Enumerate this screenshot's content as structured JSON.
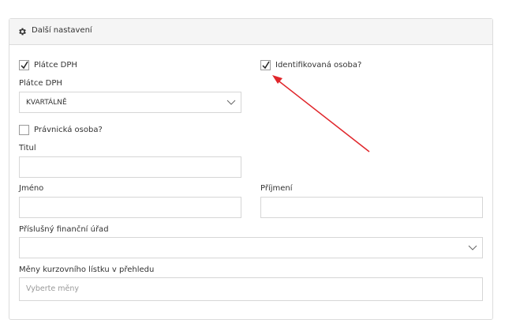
{
  "panel": {
    "title": "Další nastavení",
    "icon": "gear-icon"
  },
  "vat_payer_checkbox": {
    "label": "Plátce DPH",
    "checked": true
  },
  "identified_person_checkbox": {
    "label": "Identifikovaná osoba?",
    "checked": true
  },
  "vat_period": {
    "label": "Plátce DPH",
    "value": "KVARTÁLNĚ"
  },
  "legal_entity_checkbox": {
    "label": "Právnická osoba?",
    "checked": false
  },
  "title_field": {
    "label": "Titul",
    "value": ""
  },
  "first_name_field": {
    "label": "Jméno",
    "value": ""
  },
  "last_name_field": {
    "label": "Příjmení",
    "value": ""
  },
  "tax_office": {
    "label": "Příslušný finanční úřad",
    "value": ""
  },
  "currencies": {
    "label": "Měny kurzovního lístku v přehledu",
    "placeholder": "Vyberte měny"
  },
  "annotation": {
    "color": "#e0262b"
  }
}
